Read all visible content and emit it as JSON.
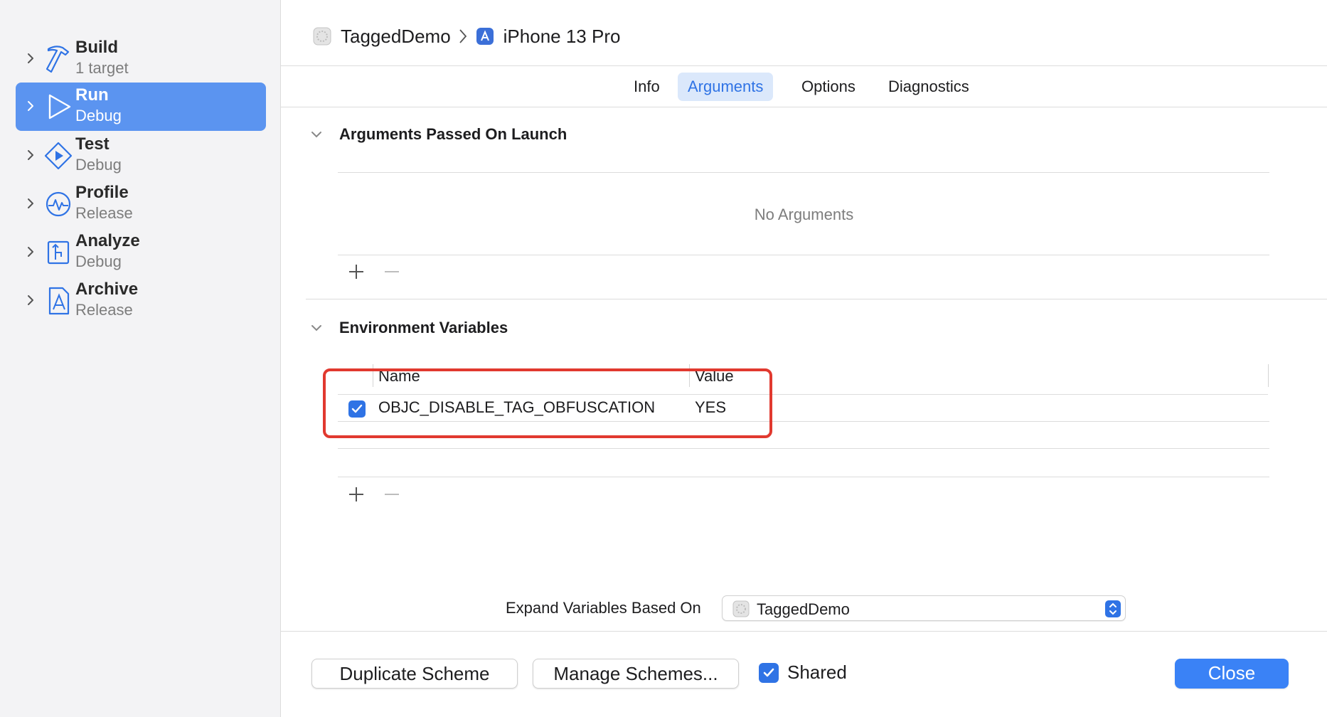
{
  "sidebar": {
    "items": [
      {
        "label": "Build",
        "sub": "1 target",
        "icon": "hammer-icon"
      },
      {
        "label": "Run",
        "sub": "Debug",
        "icon": "play-icon"
      },
      {
        "label": "Test",
        "sub": "Debug",
        "icon": "test-diamond-icon"
      },
      {
        "label": "Profile",
        "sub": "Release",
        "icon": "waveform-icon"
      },
      {
        "label": "Analyze",
        "sub": "Debug",
        "icon": "analyze-icon"
      },
      {
        "label": "Archive",
        "sub": "Release",
        "icon": "archive-icon"
      }
    ],
    "selected": "Run"
  },
  "breadcrumb": {
    "project": "TaggedDemo",
    "device": "iPhone 13 Pro"
  },
  "tabs": [
    {
      "label": "Info"
    },
    {
      "label": "Arguments"
    },
    {
      "label": "Options"
    },
    {
      "label": "Diagnostics"
    }
  ],
  "active_tab": "Arguments",
  "arguments_section": {
    "title": "Arguments Passed On Launch",
    "empty_message": "No Arguments"
  },
  "env_section": {
    "title": "Environment Variables",
    "columns": [
      "Name",
      "Value"
    ],
    "rows": [
      {
        "enabled": true,
        "name": "OBJC_DISABLE_TAG_OBFUSCATION",
        "value": "YES"
      }
    ]
  },
  "expand": {
    "label": "Expand Variables Based On",
    "selected": "TaggedDemo"
  },
  "footer": {
    "duplicate": "Duplicate Scheme",
    "manage": "Manage Schemes...",
    "shared_label": "Shared",
    "shared_checked": true,
    "close": "Close"
  },
  "colors": {
    "accent": "#2f73e5",
    "selection": "#5b94f0",
    "highlight_box": "#e1392f"
  }
}
